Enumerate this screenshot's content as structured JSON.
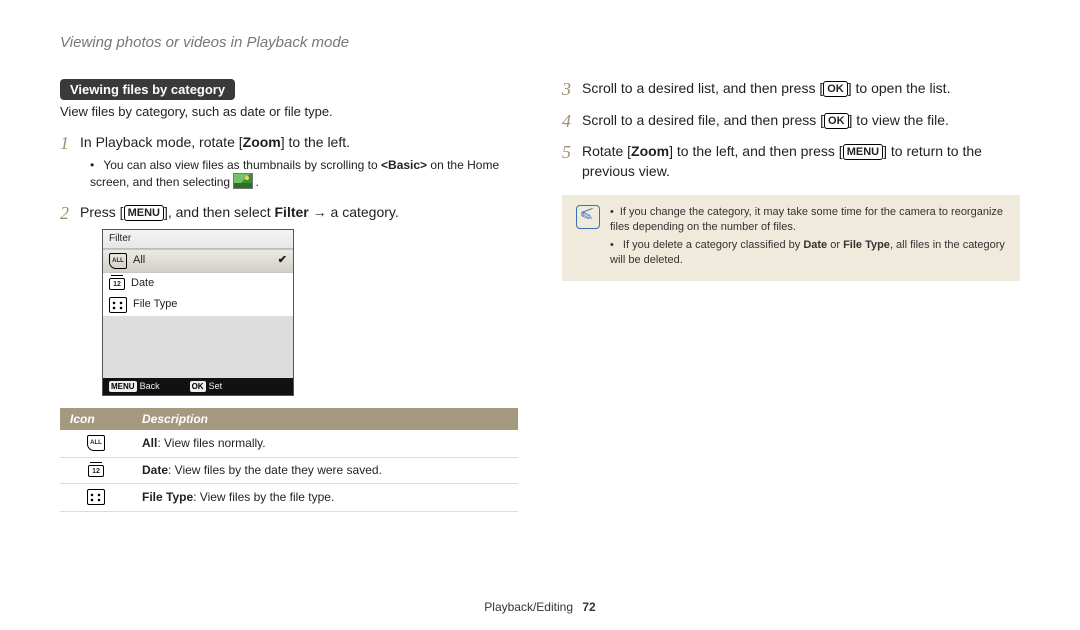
{
  "header": "Viewing photos or videos in Playback mode",
  "section_pill": "Viewing files by category",
  "section_subdesc": "View files by category, such as date or file type.",
  "left_steps": {
    "1": {
      "num": "1",
      "pre": "In Playback mode, rotate [",
      "zoom": "Zoom",
      "post": "] to the left."
    },
    "1_sub": {
      "pre": "You can also view files as thumbnails by scrolling to ",
      "basic": "<Basic>",
      "mid": " on the Home screen, and then selecting ",
      "post": "."
    },
    "2": {
      "num": "2",
      "pre": "Press [",
      "menu": "MENU",
      "mid": "], and then select ",
      "filter": "Filter",
      "arrow": " → a category."
    }
  },
  "filter_menu": {
    "title": "Filter",
    "rows": [
      "All",
      "Date",
      "File Type"
    ],
    "footer_back_btn": "MENU",
    "footer_back_lbl": "Back",
    "footer_set_btn": "OK",
    "footer_set_lbl": "Set"
  },
  "table": {
    "head_icon": "Icon",
    "head_desc": "Description",
    "rows": [
      {
        "bold": "All",
        "rest": ": View files normally."
      },
      {
        "bold": "Date",
        "rest": ": View files by the date they were saved."
      },
      {
        "bold": "File Type",
        "rest": ": View files by the file type."
      }
    ]
  },
  "right_steps": {
    "3": {
      "num": "3",
      "pre": "Scroll to a desired list, and then press [",
      "ok": "OK",
      "post": "] to open the list."
    },
    "4": {
      "num": "4",
      "pre": "Scroll to a desired file, and then press [",
      "ok": "OK",
      "post": "] to view the file."
    },
    "5": {
      "num": "5",
      "pre": "Rotate [",
      "zoom": "Zoom",
      "mid": "] to the left, and then press [",
      "menu": "MENU",
      "post": "] to return to the previous view."
    }
  },
  "note": {
    "l1": "If you change the category, it may take some time for the camera to reorganize files depending on the number of files.",
    "l2_pre": "If you delete a category classified by ",
    "l2_b1": "Date",
    "l2_mid": " or ",
    "l2_b2": "File Type",
    "l2_post": ", all files in the category will be deleted."
  },
  "footer": {
    "section": "Playback/Editing",
    "page": "72"
  }
}
